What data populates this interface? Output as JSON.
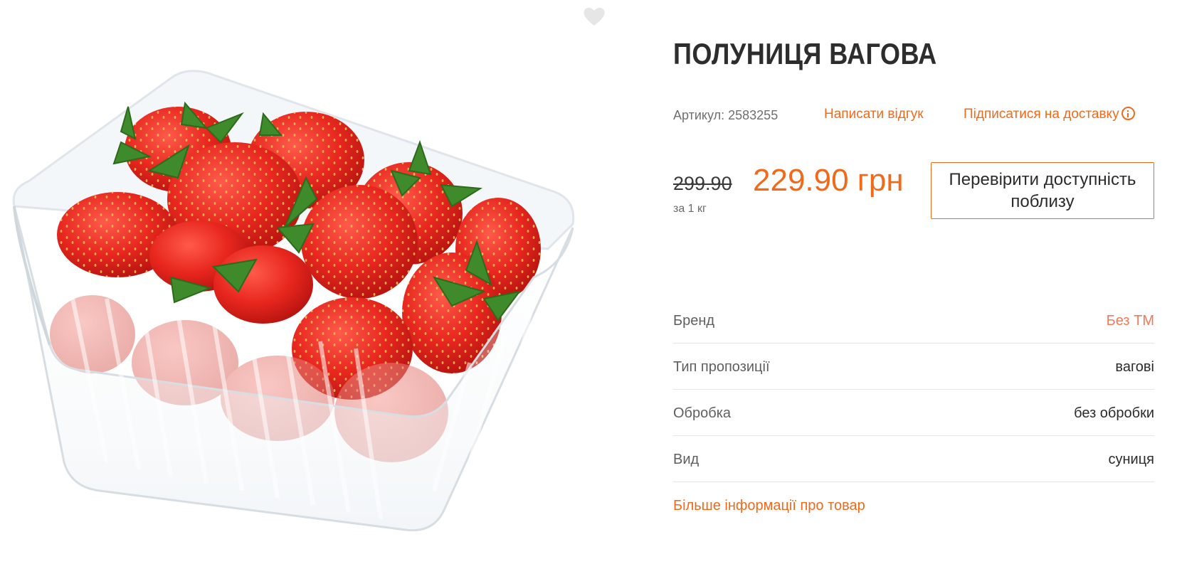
{
  "product": {
    "title": "ПОЛУНИЦЯ ВАГОВА",
    "sku_label": "Артикул:",
    "sku_value": "2583255",
    "review_link": "Написати відгук",
    "subscribe_link": "Підписатися на доставку",
    "old_price": "299.90",
    "new_price": "229.90 грн",
    "unit": "за 1 кг",
    "availability_button": "Перевірити доступність поблизу",
    "more_info_link": "Більше інформації про товар"
  },
  "specs": [
    {
      "key": "Бренд",
      "value": "Без ТМ"
    },
    {
      "key": "Тип пропозиції",
      "value": "вагові"
    },
    {
      "key": "Обробка",
      "value": "без обробки"
    },
    {
      "key": "Вид",
      "value": "суниця"
    }
  ],
  "icons": {
    "favorite": "heart-icon",
    "info": "info-icon"
  },
  "colors": {
    "accent": "#f06a1c",
    "brand_value": "#f07a56",
    "text": "#2b2b2b",
    "muted": "#6f6f6f"
  }
}
